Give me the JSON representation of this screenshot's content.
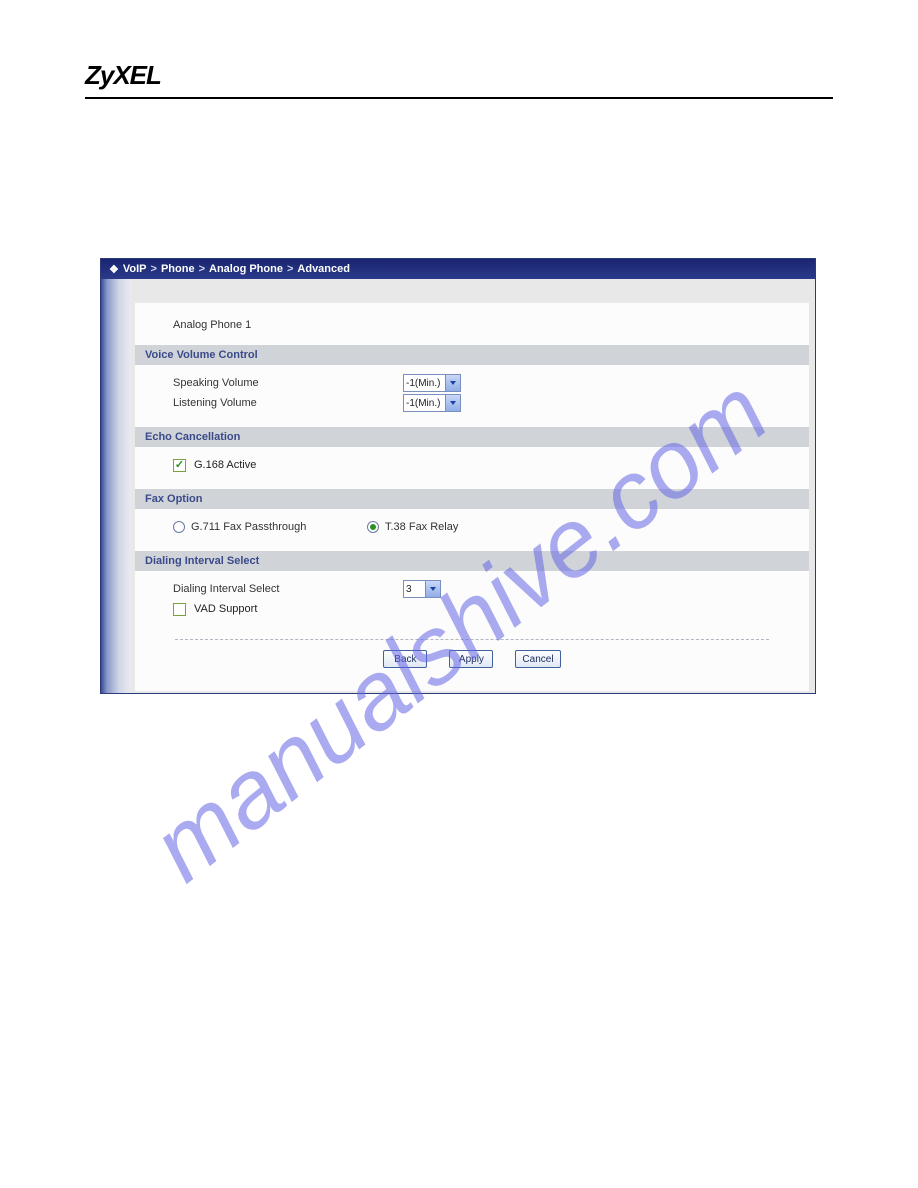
{
  "header": {
    "brand": "ZyXEL"
  },
  "watermark": "manualshive.com",
  "breadcrumb": {
    "bullet": "❖",
    "items": [
      "VoIP",
      "Phone",
      "Analog Phone",
      "Advanced"
    ],
    "sep": ">"
  },
  "panel": {
    "title": "Analog Phone 1"
  },
  "sections": {
    "voice": {
      "header": "Voice Volume Control",
      "speaking_label": "Speaking Volume",
      "speaking_value": "-1(Min.)",
      "listening_label": "Listening Volume",
      "listening_value": "-1(Min.)"
    },
    "echo": {
      "header": "Echo Cancellation",
      "g168_label": "G.168 Active",
      "g168_checked": true
    },
    "fax": {
      "header": "Fax Option",
      "g711_label": "G.711 Fax Passthrough",
      "t38_label": "T.38 Fax Relay",
      "selected": "t38"
    },
    "dialing": {
      "header": "Dialing Interval Select",
      "interval_label": "Dialing Interval Select",
      "interval_value": "3",
      "vad_label": "VAD Support",
      "vad_checked": false
    }
  },
  "buttons": {
    "back": "Back",
    "apply": "Apply",
    "cancel": "Cancel"
  }
}
